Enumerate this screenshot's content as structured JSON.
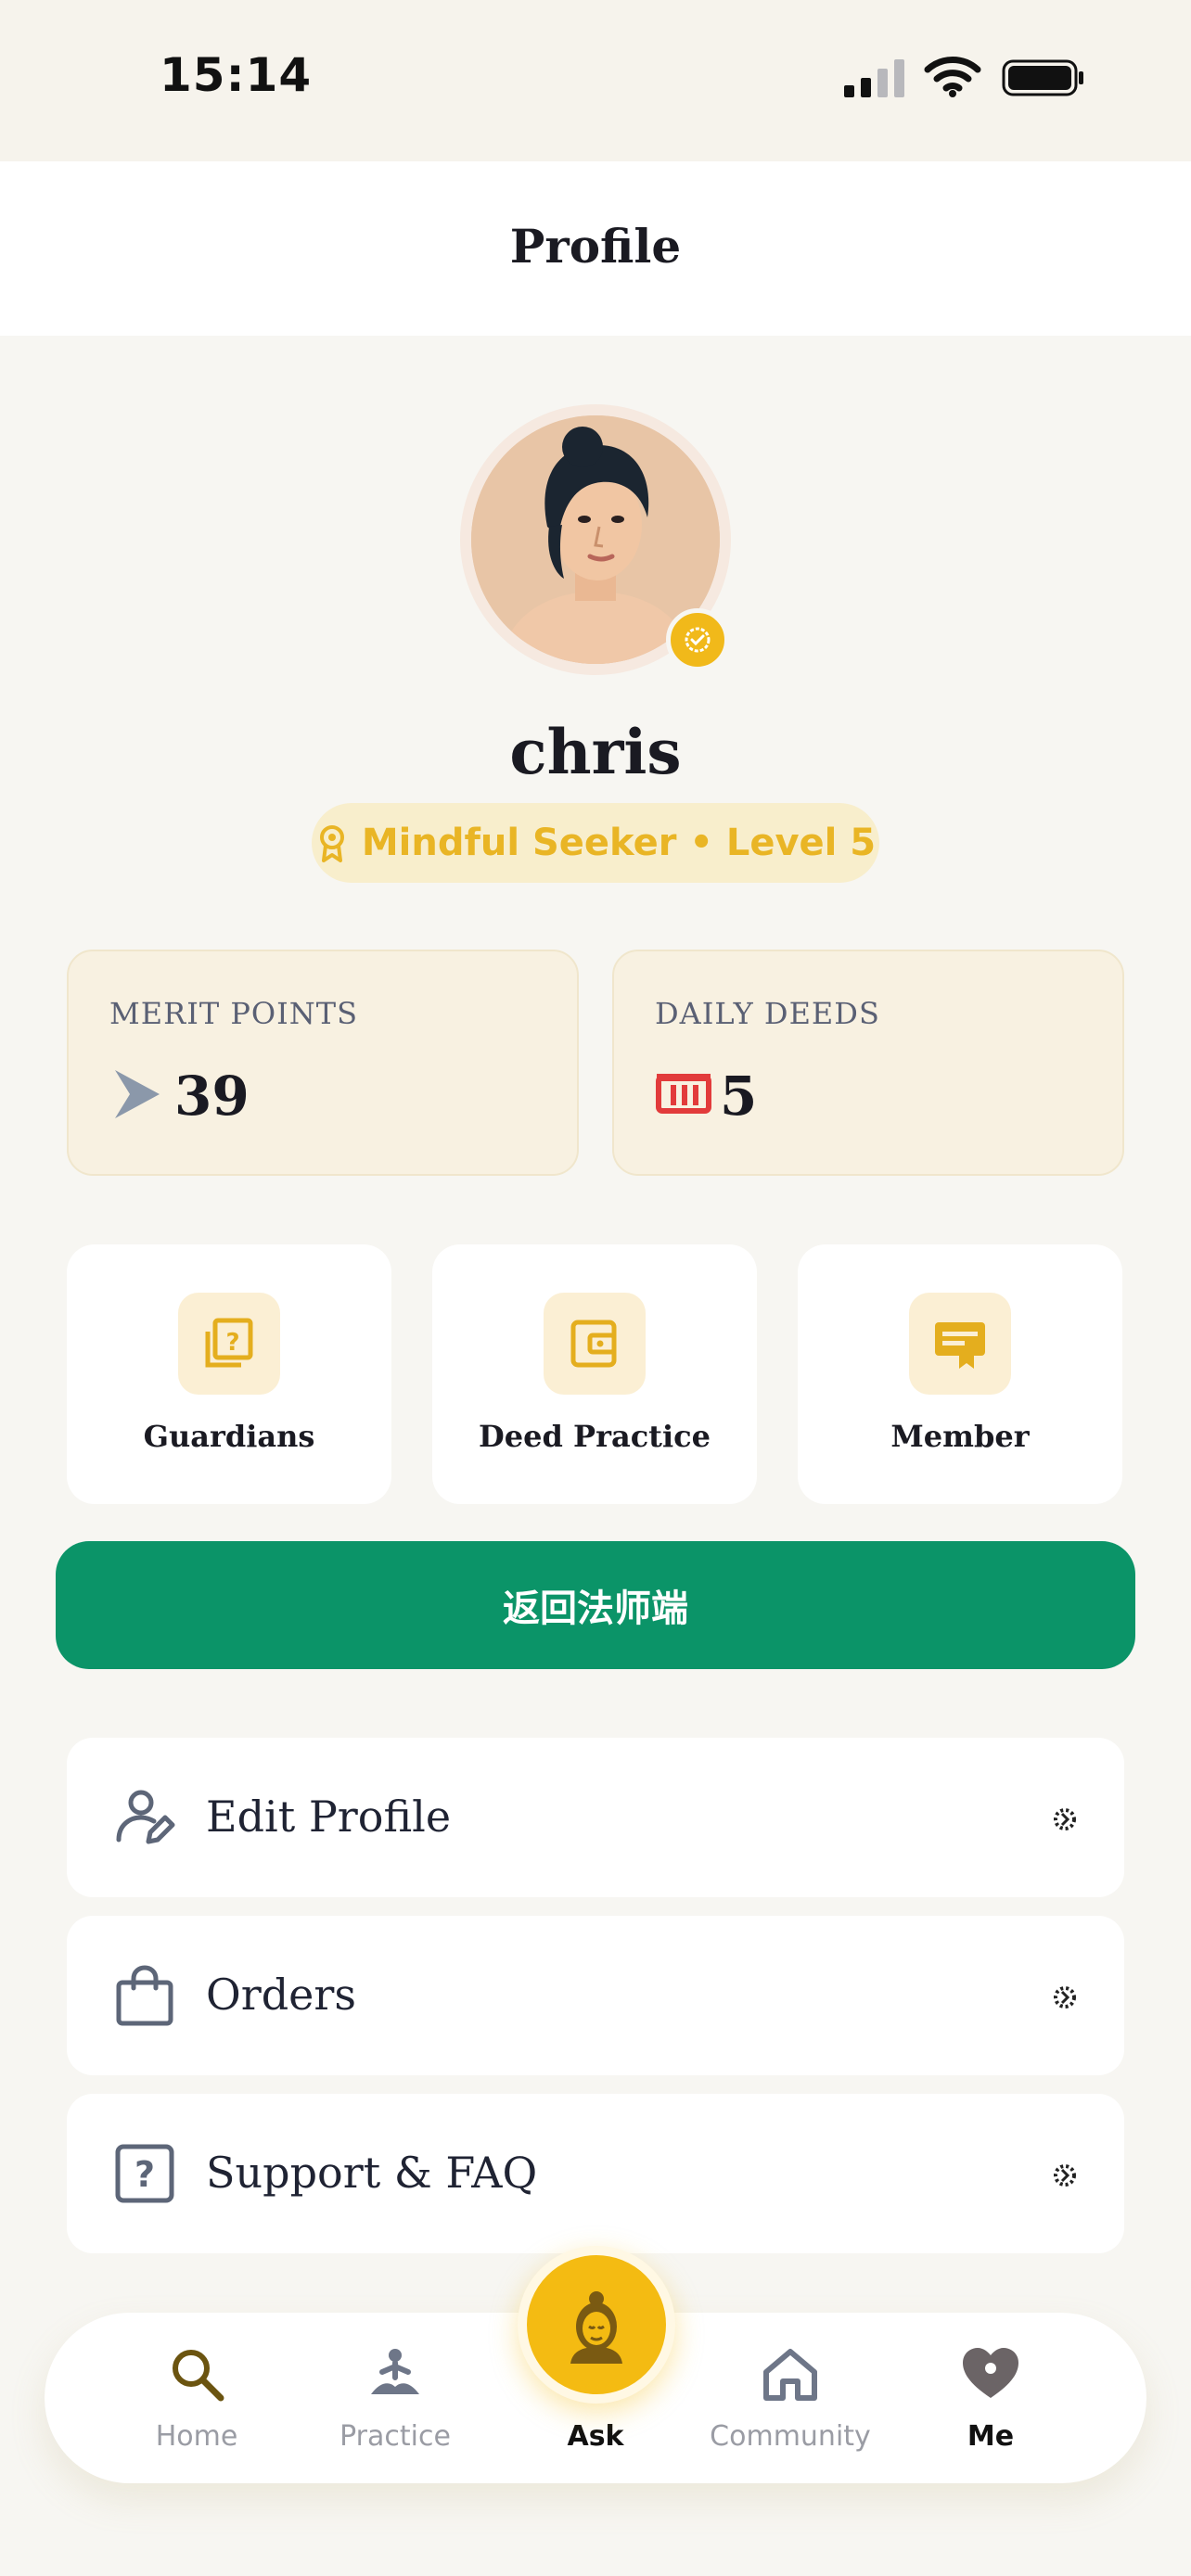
{
  "status_bar": {
    "time": "15:14"
  },
  "header": {
    "title": "Profile"
  },
  "profile": {
    "name": "chris",
    "level": "Mindful Seeker • Level 5"
  },
  "stats": [
    {
      "label": "MERIT POINTS",
      "value": "39",
      "icon": "chevron-right-icon"
    },
    {
      "label": "DAILY DEEDS",
      "value": "5",
      "icon": "calendar-icon"
    }
  ],
  "tiles": [
    {
      "label": "Guardians",
      "icon": "question-cards-icon"
    },
    {
      "label": "Deed Practice",
      "icon": "wallet-icon"
    },
    {
      "label": "Member",
      "icon": "certificate-icon"
    }
  ],
  "return_button": {
    "label": "返回法师端"
  },
  "menu": [
    {
      "label": "Edit Profile",
      "icon": "user-edit-icon"
    },
    {
      "label": "Orders",
      "icon": "shopping-bag-icon"
    },
    {
      "label": "Support & FAQ",
      "icon": "question-icon"
    }
  ],
  "nav": {
    "items": [
      {
        "label": "Home",
        "icon": "search-icon"
      },
      {
        "label": "Practice",
        "icon": "meditation-icon"
      },
      {
        "label": "Ask",
        "icon": "buddha-icon"
      },
      {
        "label": "Community",
        "icon": "house-icon"
      },
      {
        "label": "Me",
        "icon": "heart-icon"
      }
    ],
    "active": "Me"
  },
  "colors": {
    "accent_gold": "#f1b91a",
    "accent_green": "#0b9468",
    "background": "#f7f6f2",
    "deeds_red": "#e23b3b"
  }
}
